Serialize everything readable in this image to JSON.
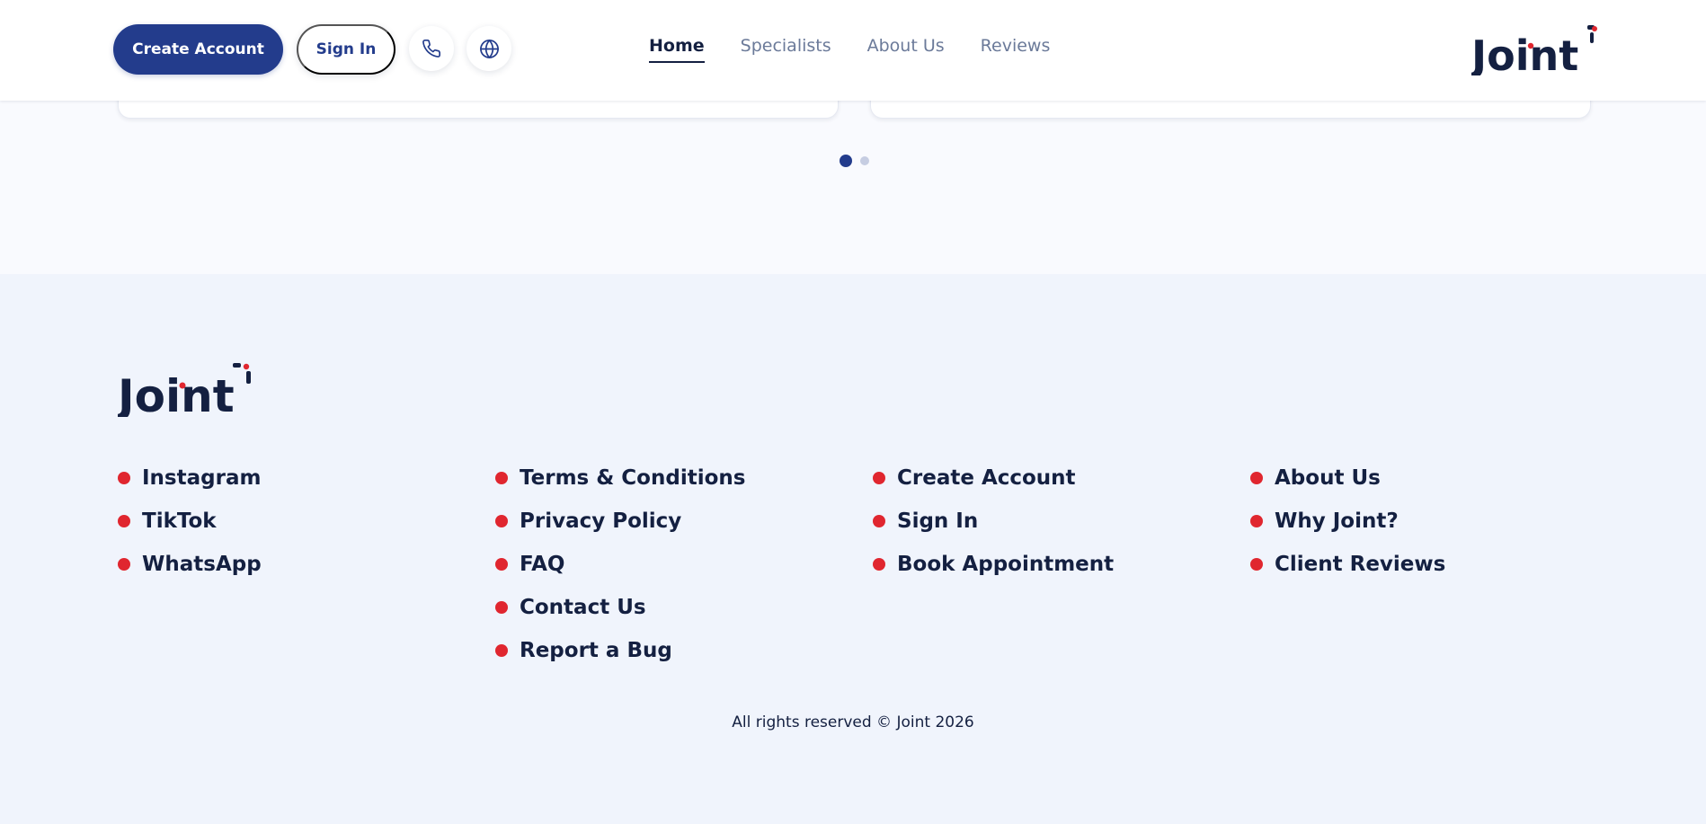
{
  "header": {
    "create_account_label": "Create Account",
    "sign_in_label": "Sign In",
    "phone_icon": "phone-icon",
    "globe_icon": "globe-icon",
    "nav": [
      {
        "label": "Home",
        "active": true
      },
      {
        "label": "Specialists",
        "active": false
      },
      {
        "label": "About Us",
        "active": false
      },
      {
        "label": "Reviews",
        "active": false
      }
    ],
    "logo_text": "Joint"
  },
  "carousel": {
    "dots": 2,
    "active_dot": 1
  },
  "footer": {
    "logo_text": "Joint",
    "columns": [
      [
        "Instagram",
        "TikTok",
        "WhatsApp"
      ],
      [
        "Terms & Conditions",
        "Privacy Policy",
        "FAQ",
        "Contact Us",
        "Report a Bug"
      ],
      [
        "Create Account",
        "Sign In",
        "Book Appointment"
      ],
      [
        "About Us",
        "Why Joint?",
        "Client Reviews"
      ]
    ],
    "copyright": "All rights reserved © Joint 2026"
  },
  "colors": {
    "primary": "#233c8c",
    "accent": "#e0262f",
    "text": "#142041",
    "muted": "#6b7a99",
    "footer_bg": "#f0f4fc"
  }
}
